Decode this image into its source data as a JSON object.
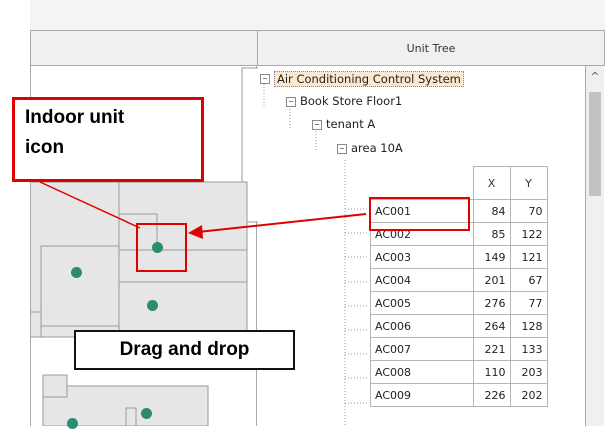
{
  "panel": {
    "title": "Unit Tree"
  },
  "tree": {
    "root": "Air Conditioning Control System",
    "floor": "Book Store Floor1",
    "tenant": "tenant A",
    "area": "area 10A",
    "collapse_glyph": "−"
  },
  "unit_table": {
    "columns": [
      "X",
      "Y"
    ],
    "rows": [
      {
        "name": "AC001",
        "x": "84",
        "y": "70"
      },
      {
        "name": "AC002",
        "x": "85",
        "y": "122"
      },
      {
        "name": "AC003",
        "x": "149",
        "y": "121"
      },
      {
        "name": "AC004",
        "x": "201",
        "y": "67"
      },
      {
        "name": "AC005",
        "x": "276",
        "y": "77"
      },
      {
        "name": "AC006",
        "x": "264",
        "y": "128"
      },
      {
        "name": "AC007",
        "x": "221",
        "y": "133"
      },
      {
        "name": "AC008",
        "x": "110",
        "y": "203"
      },
      {
        "name": "AC009",
        "x": "226",
        "y": "202"
      }
    ]
  },
  "scroll": {
    "up_glyph": "^"
  },
  "annotations": {
    "indoor_unit_line1": "Indoor unit",
    "indoor_unit_line2": "icon",
    "drag_drop": "Drag and drop"
  },
  "colors": {
    "highlight": "#e00000",
    "unit_icon": "#2e8b73",
    "floor_fill": "#e6e6e6"
  },
  "icons": {
    "unit": "indoor-unit-icon"
  }
}
